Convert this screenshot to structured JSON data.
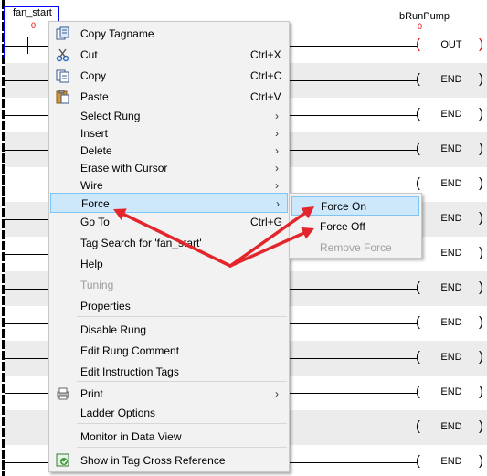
{
  "ladder": {
    "contact_tag": "fan_start",
    "contact_value": "0",
    "coil_tag": "bRunPump",
    "coil_value": "0",
    "coil_labels": [
      "OUT",
      "END",
      "END",
      "END",
      "END",
      "END",
      "END",
      "END",
      "END",
      "END",
      "END",
      "END",
      "END"
    ]
  },
  "menu": {
    "items": [
      {
        "label": "Copy Tagname",
        "shortcut": "",
        "submenu": false,
        "icon": "copy-tagname-icon"
      },
      {
        "label": "Cut",
        "shortcut": "Ctrl+X",
        "submenu": false,
        "icon": "scissors-icon"
      },
      {
        "label": "Copy",
        "shortcut": "Ctrl+C",
        "submenu": false,
        "icon": "copy-icon"
      },
      {
        "label": "Paste",
        "shortcut": "Ctrl+V",
        "submenu": false,
        "icon": "paste-icon"
      },
      {
        "label": "Select Rung",
        "shortcut": "",
        "submenu": true
      },
      {
        "label": "Insert",
        "shortcut": "",
        "submenu": true
      },
      {
        "label": "Delete",
        "shortcut": "",
        "submenu": true
      },
      {
        "label": "Erase with Cursor",
        "shortcut": "",
        "submenu": true
      },
      {
        "label": "Wire",
        "shortcut": "",
        "submenu": true
      },
      {
        "label": "Force",
        "shortcut": "",
        "submenu": true,
        "hover": true
      },
      {
        "label": "Go To",
        "shortcut": "Ctrl+G",
        "submenu": false
      },
      {
        "label": "Tag Search for  'fan_start'",
        "shortcut": "",
        "submenu": false
      },
      {
        "label": "Help",
        "shortcut": "",
        "submenu": false
      },
      {
        "label": "Tuning",
        "shortcut": "",
        "submenu": false,
        "disabled": true
      },
      {
        "label": "Properties",
        "shortcut": "",
        "submenu": false
      },
      {
        "label": "Disable Rung",
        "shortcut": "",
        "submenu": false
      },
      {
        "label": "Edit Rung Comment",
        "shortcut": "",
        "submenu": false
      },
      {
        "label": "Edit Instruction Tags",
        "shortcut": "",
        "submenu": false
      },
      {
        "label": "Print",
        "shortcut": "",
        "submenu": true,
        "icon": "print-icon"
      },
      {
        "label": "Ladder Options",
        "shortcut": "",
        "submenu": false
      },
      {
        "label": "Monitor in Data View",
        "shortcut": "",
        "submenu": false
      },
      {
        "label": "Show in Tag Cross Reference",
        "shortcut": "",
        "submenu": false,
        "icon": "cross-reference-icon"
      }
    ]
  },
  "submenu": {
    "items": [
      {
        "label": "Force On",
        "hover": true
      },
      {
        "label": "Force Off"
      },
      {
        "label": "Remove Force",
        "disabled": true
      }
    ]
  },
  "colors": {
    "arrow": "#e3262b",
    "hover_bg": "#cde8fb",
    "hover_border": "#80c4f4",
    "menu_bg": "#f2f2f2",
    "selection_box": "#0000ff",
    "coil_paren": "#e00000"
  }
}
